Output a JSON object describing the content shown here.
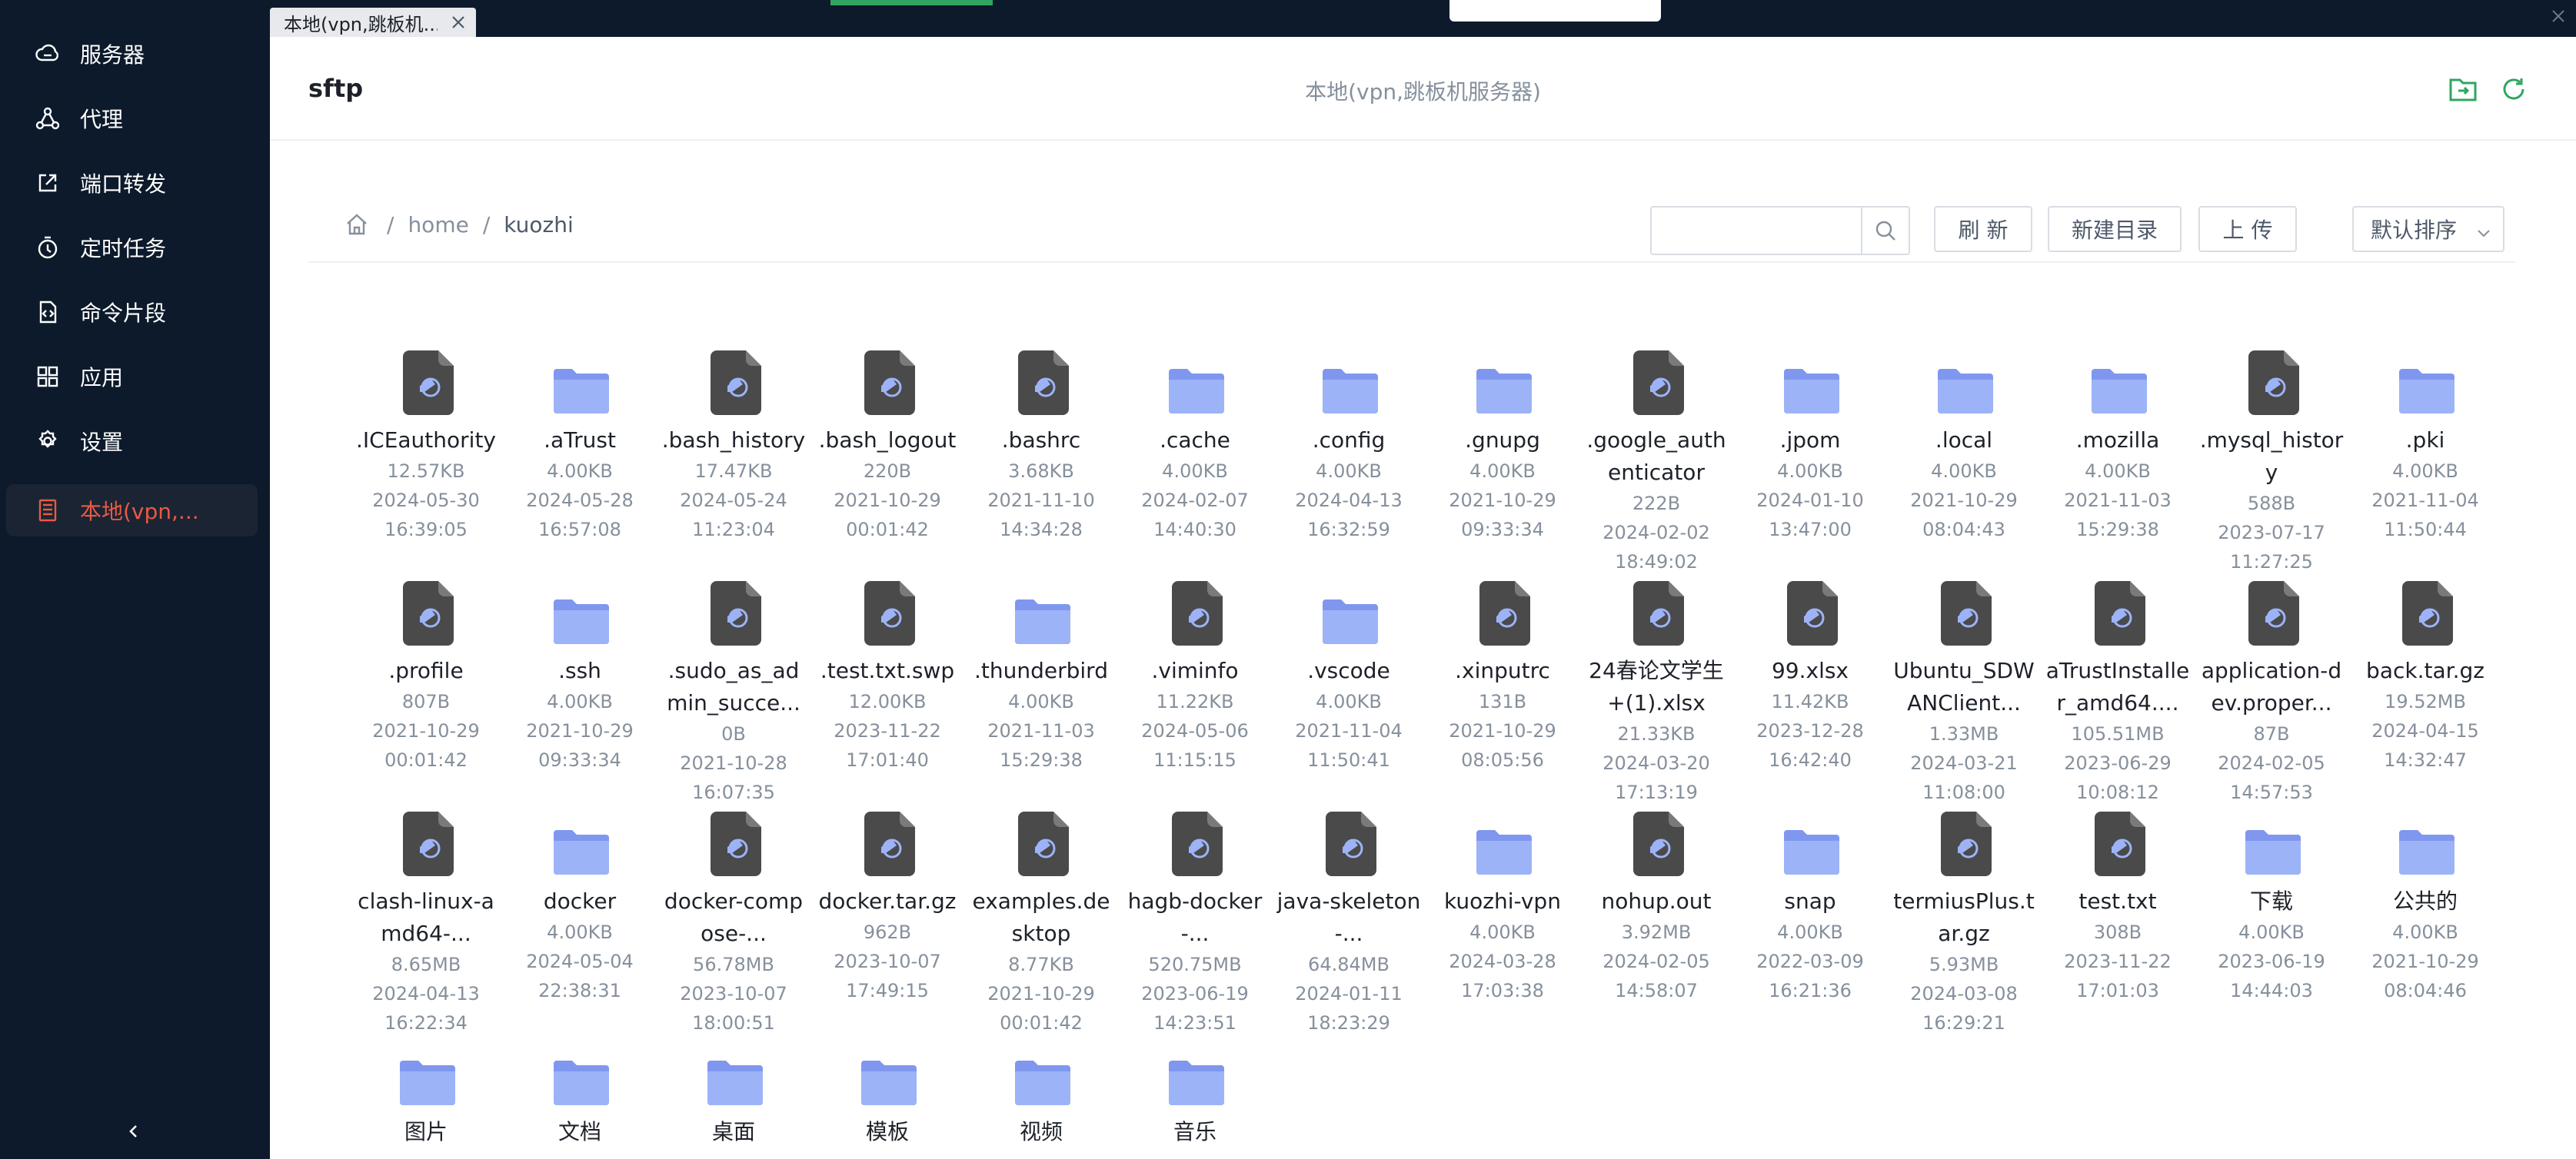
{
  "sidebar": {
    "items": [
      {
        "label": "服务器",
        "icon": "cloud-server-icon"
      },
      {
        "label": "代理",
        "icon": "network-icon"
      },
      {
        "label": "端口转发",
        "icon": "forward-icon"
      },
      {
        "label": "定时任务",
        "icon": "timer-icon"
      },
      {
        "label": "命令片段",
        "icon": "code-file-icon"
      },
      {
        "label": "应用",
        "icon": "apps-icon"
      },
      {
        "label": "设置",
        "icon": "gear-icon"
      },
      {
        "label": "本地(vpn,...",
        "icon": "server-icon",
        "active": true
      }
    ]
  },
  "tab": {
    "label": "本地(vpn,跳板机..."
  },
  "header": {
    "title": "sftp",
    "center": "本地(vpn,跳板机服务器)"
  },
  "breadcrumb": {
    "home_icon": "home-icon",
    "items": [
      "home",
      "kuozhi"
    ],
    "separator": "/"
  },
  "toolbar": {
    "search_placeholder": "",
    "refresh": "刷 新",
    "new_dir": "新建目录",
    "upload": "上 传",
    "sort": "默认排序"
  },
  "colors": {
    "sidebar_bg": "#0c1a2b",
    "active": "#e85a44",
    "folder": "#8fa8f5",
    "file": "#4a4a4a",
    "accent": "#2fa561"
  },
  "files": [
    {
      "type": "file",
      "name": ".ICEauthority",
      "size": "12.57KB",
      "date": "2024-05-30",
      "time": "16:39:05"
    },
    {
      "type": "folder",
      "name": ".aTrust",
      "size": "4.00KB",
      "date": "2024-05-28",
      "time": "16:57:08"
    },
    {
      "type": "file",
      "name": ".bash_history",
      "size": "17.47KB",
      "date": "2024-05-24",
      "time": "11:23:04"
    },
    {
      "type": "file",
      "name": ".bash_logout",
      "size": "220B",
      "date": "2021-10-29",
      "time": "00:01:42"
    },
    {
      "type": "file",
      "name": ".bashrc",
      "size": "3.68KB",
      "date": "2021-11-10",
      "time": "14:34:28"
    },
    {
      "type": "folder",
      "name": ".cache",
      "size": "4.00KB",
      "date": "2024-02-07",
      "time": "14:40:30"
    },
    {
      "type": "folder",
      "name": ".config",
      "size": "4.00KB",
      "date": "2024-04-13",
      "time": "16:32:59"
    },
    {
      "type": "folder",
      "name": ".gnupg",
      "size": "4.00KB",
      "date": "2021-10-29",
      "time": "09:33:34"
    },
    {
      "type": "file",
      "name": ".google_authenticator",
      "size": "222B",
      "date": "2024-02-02",
      "time": "18:49:02"
    },
    {
      "type": "folder",
      "name": ".jpom",
      "size": "4.00KB",
      "date": "2024-01-10",
      "time": "13:47:00"
    },
    {
      "type": "folder",
      "name": ".local",
      "size": "4.00KB",
      "date": "2021-10-29",
      "time": "08:04:43"
    },
    {
      "type": "folder",
      "name": ".mozilla",
      "size": "4.00KB",
      "date": "2021-11-03",
      "time": "15:29:38"
    },
    {
      "type": "file",
      "name": ".mysql_history",
      "size": "588B",
      "date": "2023-07-17",
      "time": "11:27:25"
    },
    {
      "type": "folder",
      "name": ".pki",
      "size": "4.00KB",
      "date": "2021-11-04",
      "time": "11:50:44"
    },
    {
      "type": "file",
      "name": ".profile",
      "size": "807B",
      "date": "2021-10-29",
      "time": "00:01:42"
    },
    {
      "type": "folder",
      "name": ".ssh",
      "size": "4.00KB",
      "date": "2021-10-29",
      "time": "09:33:34"
    },
    {
      "type": "file",
      "name": ".sudo_as_admin_succe...",
      "size": "0B",
      "date": "2021-10-28",
      "time": "16:07:35"
    },
    {
      "type": "file",
      "name": ".test.txt.swp",
      "size": "12.00KB",
      "date": "2023-11-22",
      "time": "17:01:40"
    },
    {
      "type": "folder",
      "name": ".thunderbird",
      "size": "4.00KB",
      "date": "2021-11-03",
      "time": "15:29:38"
    },
    {
      "type": "file",
      "name": ".viminfo",
      "size": "11.22KB",
      "date": "2024-05-06",
      "time": "11:15:15"
    },
    {
      "type": "folder",
      "name": ".vscode",
      "size": "4.00KB",
      "date": "2021-11-04",
      "time": "11:50:41"
    },
    {
      "type": "file",
      "name": ".xinputrc",
      "size": "131B",
      "date": "2021-10-29",
      "time": "08:05:56"
    },
    {
      "type": "file",
      "name": "24春论文学生+(1).xlsx",
      "size": "21.33KB",
      "date": "2024-03-20",
      "time": "17:13:19"
    },
    {
      "type": "file",
      "name": "99.xlsx",
      "size": "11.42KB",
      "date": "2023-12-28",
      "time": "16:42:40"
    },
    {
      "type": "file",
      "name": "Ubuntu_SDWANClient...",
      "size": "1.33MB",
      "date": "2024-03-21",
      "time": "11:08:00"
    },
    {
      "type": "file",
      "name": "aTrustInstaller_amd64....",
      "size": "105.51MB",
      "date": "2023-06-29",
      "time": "10:08:12"
    },
    {
      "type": "file",
      "name": "application-dev.proper...",
      "size": "87B",
      "date": "2024-02-05",
      "time": "14:57:53"
    },
    {
      "type": "file",
      "name": "back.tar.gz",
      "size": "19.52MB",
      "date": "2024-04-15",
      "time": "14:32:47"
    },
    {
      "type": "file",
      "name": "clash-linux-amd64-...",
      "size": "8.65MB",
      "date": "2024-04-13",
      "time": "16:22:34"
    },
    {
      "type": "folder",
      "name": "docker",
      "size": "4.00KB",
      "date": "2024-05-04",
      "time": "22:38:31"
    },
    {
      "type": "file",
      "name": "docker-compose-...",
      "size": "56.78MB",
      "date": "2023-10-07",
      "time": "18:00:51"
    },
    {
      "type": "file",
      "name": "docker.tar.gz",
      "size": "962B",
      "date": "2023-10-07",
      "time": "17:49:15"
    },
    {
      "type": "file",
      "name": "examples.desktop",
      "size": "8.77KB",
      "date": "2021-10-29",
      "time": "00:01:42"
    },
    {
      "type": "file",
      "name": "hagb-docker-...",
      "size": "520.75MB",
      "date": "2023-06-19",
      "time": "14:23:51"
    },
    {
      "type": "file",
      "name": "java-skeleton-...",
      "size": "64.84MB",
      "date": "2024-01-11",
      "time": "18:23:29"
    },
    {
      "type": "folder",
      "name": "kuozhi-vpn",
      "size": "4.00KB",
      "date": "2024-03-28",
      "time": "17:03:38"
    },
    {
      "type": "file",
      "name": "nohup.out",
      "size": "3.92MB",
      "date": "2024-02-05",
      "time": "14:58:07"
    },
    {
      "type": "folder",
      "name": "snap",
      "size": "4.00KB",
      "date": "2022-03-09",
      "time": "16:21:36"
    },
    {
      "type": "file",
      "name": "termiusPlus.tar.gz",
      "size": "5.93MB",
      "date": "2024-03-08",
      "time": "16:29:21"
    },
    {
      "type": "file",
      "name": "test.txt",
      "size": "308B",
      "date": "2023-11-22",
      "time": "17:01:03"
    },
    {
      "type": "folder",
      "name": "下载",
      "size": "4.00KB",
      "date": "2023-06-19",
      "time": "14:44:03"
    },
    {
      "type": "folder",
      "name": "公共的",
      "size": "4.00KB",
      "date": "2021-10-29",
      "time": "08:04:46"
    },
    {
      "type": "folder",
      "name": "图片"
    },
    {
      "type": "folder",
      "name": "文档"
    },
    {
      "type": "folder",
      "name": "桌面"
    },
    {
      "type": "folder",
      "name": "模板"
    },
    {
      "type": "folder",
      "name": "视频"
    },
    {
      "type": "folder",
      "name": "音乐"
    }
  ]
}
